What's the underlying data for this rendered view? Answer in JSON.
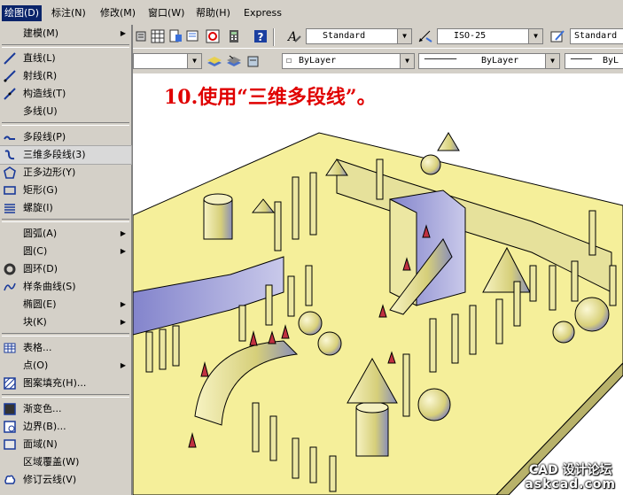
{
  "menubar": {
    "items": [
      {
        "label": "绘图(D)",
        "active": true
      },
      {
        "label": "标注(N)",
        "active": false
      },
      {
        "label": "修改(M)",
        "active": false
      },
      {
        "label": "窗口(W)",
        "active": false
      },
      {
        "label": "帮助(H)",
        "active": false
      },
      {
        "label": "Express",
        "active": false
      }
    ]
  },
  "toolbar": {
    "text_style": "Standard",
    "dim_style": "ISO-25",
    "table_style": "Standard",
    "layer_color": "ByLayer",
    "linetype": "ByLayer",
    "lineweight": "ByL"
  },
  "drawing": {
    "step_text": "10.使用“三维多段线”。",
    "watermark_line1": "CAD 设计论坛",
    "watermark_line2": "askcad.com"
  },
  "menu": {
    "items": [
      {
        "label": "建模(M)",
        "icon": "none-icon",
        "submenu": true
      },
      {
        "label": "直线(L)",
        "icon": "line-icon"
      },
      {
        "label": "射线(R)",
        "icon": "ray-icon"
      },
      {
        "label": "构造线(T)",
        "icon": "construction-line-icon"
      },
      {
        "label": "多线(U)",
        "icon": "none-icon"
      },
      {
        "label": "多段线(P)",
        "icon": "polyline-icon"
      },
      {
        "label": "三维多段线(3)",
        "icon": "3d-polyline-icon",
        "highlighted": true
      },
      {
        "label": "正多边形(Y)",
        "icon": "polygon-icon"
      },
      {
        "label": "矩形(G)",
        "icon": "rectangle-icon"
      },
      {
        "label": "螺旋(I)",
        "icon": "helix-icon"
      },
      {
        "label": "圆弧(A)",
        "icon": "none-icon",
        "submenu": true
      },
      {
        "label": "圆(C)",
        "icon": "none-icon",
        "submenu": true
      },
      {
        "label": "圆环(D)",
        "icon": "donut-icon"
      },
      {
        "label": "样条曲线(S)",
        "icon": "spline-icon"
      },
      {
        "label": "椭圆(E)",
        "icon": "none-icon",
        "submenu": true
      },
      {
        "label": "块(K)",
        "icon": "none-icon",
        "submenu": true
      },
      {
        "label": "表格...",
        "icon": "table-icon"
      },
      {
        "label": "点(O)",
        "icon": "none-icon",
        "submenu": true
      },
      {
        "label": "图案填充(H)...",
        "icon": "hatch-icon"
      },
      {
        "label": "渐变色...",
        "icon": "gradient-icon"
      },
      {
        "label": "边界(B)...",
        "icon": "boundary-icon"
      },
      {
        "label": "面域(N)",
        "icon": "region-icon"
      },
      {
        "label": "区域覆盖(W)",
        "icon": "none-icon"
      },
      {
        "label": "修订云线(V)",
        "icon": "revcloud-icon"
      }
    ]
  },
  "colors": {
    "chrome": "#d4d0c8",
    "menu_active": "#0a246a",
    "step_text": "#e00000",
    "platform": "#f5ef9a",
    "solid": "#ece7a2",
    "solid_shadow": "#6d6fc0"
  }
}
